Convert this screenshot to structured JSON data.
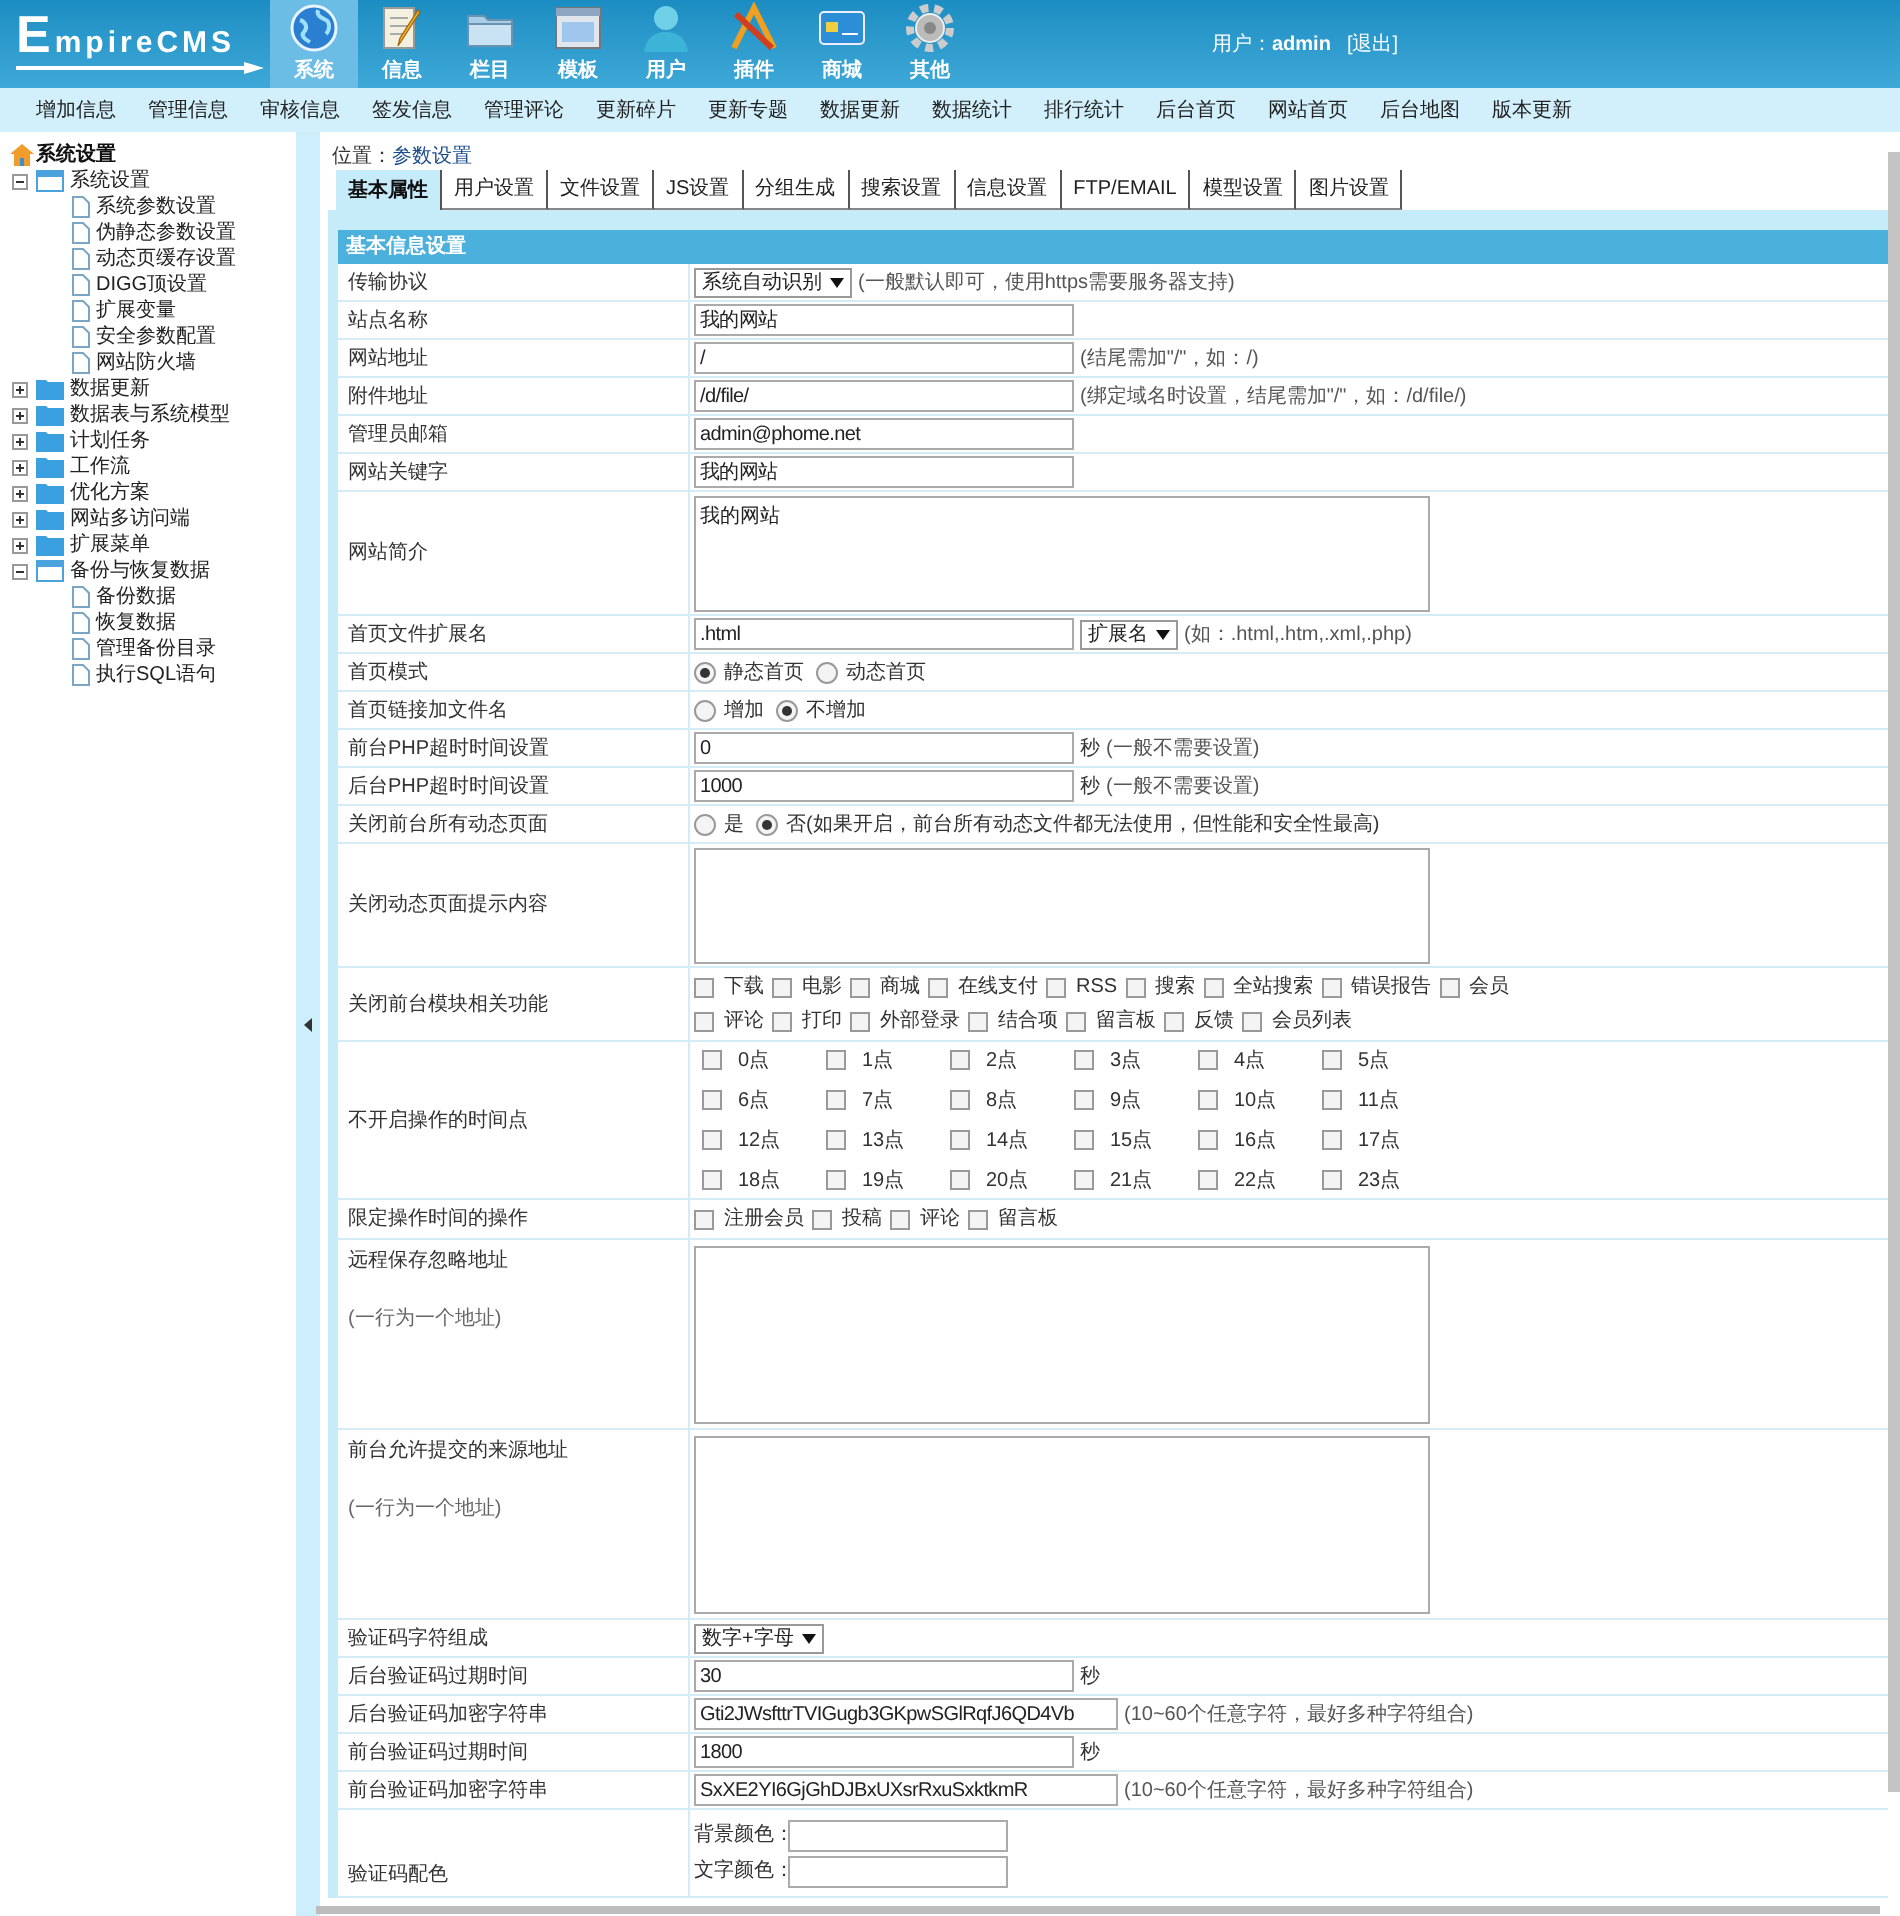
{
  "header": {
    "logo": "EmpireCMS",
    "nav": [
      {
        "label": "系统",
        "selected": true
      },
      {
        "label": "信息",
        "selected": false
      },
      {
        "label": "栏目",
        "selected": false
      },
      {
        "label": "模板",
        "selected": false
      },
      {
        "label": "用户",
        "selected": false
      },
      {
        "label": "插件",
        "selected": false
      },
      {
        "label": "商城",
        "selected": false
      },
      {
        "label": "其他",
        "selected": false
      }
    ],
    "user_label": "用户：",
    "user": "admin",
    "logout": "[退出]"
  },
  "submenu": [
    "增加信息",
    "管理信息",
    "审核信息",
    "签发信息",
    "管理评论",
    "更新碎片",
    "更新专题",
    "数据更新",
    "数据统计",
    "排行统计",
    "后台首页",
    "网站首页",
    "后台地图",
    "版本更新"
  ],
  "sidebar": {
    "title": "系统设置",
    "tree": [
      {
        "label": "系统设置",
        "expanded": true,
        "children": [
          {
            "label": "系统参数设置"
          },
          {
            "label": "伪静态参数设置"
          },
          {
            "label": "动态页缓存设置"
          },
          {
            "label": "DIGG顶设置"
          },
          {
            "label": "扩展变量"
          },
          {
            "label": "安全参数配置"
          },
          {
            "label": "网站防火墙"
          }
        ]
      },
      {
        "label": "数据更新",
        "expanded": false
      },
      {
        "label": "数据表与系统模型",
        "expanded": false
      },
      {
        "label": "计划任务",
        "expanded": false
      },
      {
        "label": "工作流",
        "expanded": false
      },
      {
        "label": "优化方案",
        "expanded": false
      },
      {
        "label": "网站多访问端",
        "expanded": false
      },
      {
        "label": "扩展菜单",
        "expanded": false
      },
      {
        "label": "备份与恢复数据",
        "expanded": true,
        "children": [
          {
            "label": "备份数据"
          },
          {
            "label": "恢复数据"
          },
          {
            "label": "管理备份目录"
          },
          {
            "label": "执行SQL语句"
          }
        ]
      }
    ]
  },
  "breadcrumb": {
    "label": "位置：",
    "link": "参数设置"
  },
  "tabs": [
    {
      "label": "基本属性",
      "selected": true
    },
    {
      "label": "用户设置",
      "selected": false
    },
    {
      "label": "文件设置",
      "selected": false
    },
    {
      "label": "JS设置",
      "selected": false
    },
    {
      "label": "分组生成",
      "selected": false
    },
    {
      "label": "搜索设置",
      "selected": false
    },
    {
      "label": "信息设置",
      "selected": false
    },
    {
      "label": "FTP/EMAIL",
      "selected": false
    },
    {
      "label": "模型设置",
      "selected": false
    },
    {
      "label": "图片设置",
      "selected": false
    }
  ],
  "section_title": "基本信息设置",
  "rows": [
    {
      "kind": "select",
      "label": "传输协议",
      "value": "系统自动识别",
      "hint": "(一般默认即可，使用https需要服务器支持)"
    },
    {
      "kind": "text",
      "label": "站点名称",
      "value": "我的网站"
    },
    {
      "kind": "text",
      "label": "网站地址",
      "value": "/",
      "hint": "(结尾需加\"/\"，如：/)"
    },
    {
      "kind": "text",
      "label": "附件地址",
      "value": "/d/file/",
      "hint": "(绑定域名时设置，结尾需加\"/\"，如：/d/file/)"
    },
    {
      "kind": "text",
      "label": "管理员邮箱",
      "value": "admin@phome.net"
    },
    {
      "kind": "text",
      "label": "网站关键字",
      "value": "我的网站"
    },
    {
      "kind": "textarea",
      "label": "网站简介",
      "value": "我的网站"
    },
    {
      "kind": "text",
      "label": "首页文件扩展名",
      "value": ".html",
      "select": "扩展名",
      "hint": "(如：.html,.htm,.xml,.php)"
    },
    {
      "kind": "radio",
      "label": "首页模式",
      "options": [
        {
          "label": "静态首页",
          "selected": true
        },
        {
          "label": "动态首页",
          "selected": false
        }
      ]
    },
    {
      "kind": "radio",
      "label": "首页链接加文件名",
      "options": [
        {
          "label": "增加",
          "selected": false
        },
        {
          "label": "不增加",
          "selected": true
        }
      ]
    },
    {
      "kind": "text",
      "label": "前台PHP超时时间设置",
      "value": "0",
      "unit": "秒",
      "hint": "(一般不需要设置)"
    },
    {
      "kind": "text",
      "label": "后台PHP超时时间设置",
      "value": "1000",
      "unit": "秒",
      "hint": "(一般不需要设置)"
    },
    {
      "kind": "radio",
      "label": "关闭前台所有动态页面",
      "options": [
        {
          "label": "是",
          "selected": false
        },
        {
          "label": "否(如果开启，前台所有动态文件都无法使用，但性能和安全性最高)",
          "selected": true
        }
      ]
    },
    {
      "kind": "textarea",
      "label": "关闭动态页面提示内容"
    },
    {
      "kind": "checks",
      "label": "关闭前台模块相关功能",
      "options": [
        {
          "label": "下载",
          "checked": false
        },
        {
          "label": "电影",
          "checked": false
        },
        {
          "label": "商城",
          "checked": false
        },
        {
          "label": "在线支付",
          "checked": false
        },
        {
          "label": "RSS",
          "checked": false
        },
        {
          "label": "搜索",
          "checked": false
        },
        {
          "label": "全站搜索",
          "checked": false
        },
        {
          "label": "错误报告",
          "checked": false
        },
        {
          "label": "会员",
          "checked": false
        },
        {
          "label": "评论",
          "checked": false
        },
        {
          "label": "打印",
          "checked": false
        },
        {
          "label": "外部登录",
          "checked": false
        },
        {
          "label": "结合项",
          "checked": false
        },
        {
          "label": "留言板",
          "checked": false
        },
        {
          "label": "反馈",
          "checked": false
        },
        {
          "label": "会员列表",
          "checked": false
        }
      ]
    },
    {
      "kind": "grid",
      "label": "不开启操作的时间点",
      "options": [
        {
          "label": "0点",
          "checked": false
        },
        {
          "label": "1点",
          "checked": false
        },
        {
          "label": "2点",
          "checked": false
        },
        {
          "label": "3点",
          "checked": false
        },
        {
          "label": "4点",
          "checked": false
        },
        {
          "label": "5点",
          "checked": false
        },
        {
          "label": "6点",
          "checked": false
        },
        {
          "label": "7点",
          "checked": false
        },
        {
          "label": "8点",
          "checked": false
        },
        {
          "label": "9点",
          "checked": false
        },
        {
          "label": "10点",
          "checked": false
        },
        {
          "label": "11点",
          "checked": false
        },
        {
          "label": "12点",
          "checked": false
        },
        {
          "label": "13点",
          "checked": false
        },
        {
          "label": "14点",
          "checked": false
        },
        {
          "label": "15点",
          "checked": false
        },
        {
          "label": "16点",
          "checked": false
        },
        {
          "label": "17点",
          "checked": false
        },
        {
          "label": "18点",
          "checked": false
        },
        {
          "label": "19点",
          "checked": false
        },
        {
          "label": "20点",
          "checked": false
        },
        {
          "label": "21点",
          "checked": false
        },
        {
          "label": "22点",
          "checked": false
        },
        {
          "label": "23点",
          "checked": false
        }
      ]
    },
    {
      "kind": "checks",
      "label": "限定操作时间的操作",
      "options": [
        {
          "label": "注册会员",
          "checked": false
        },
        {
          "label": "投稿",
          "checked": false
        },
        {
          "label": "评论",
          "checked": false
        },
        {
          "label": "留言板",
          "checked": false
        }
      ]
    },
    {
      "kind": "bigtext",
      "label": "远程保存忽略地址",
      "note": "(一行为一个地址)"
    },
    {
      "kind": "bigtext",
      "label": "前台允许提交的来源地址",
      "note": "(一行为一个地址)"
    },
    {
      "kind": "select",
      "label": "验证码字符组成",
      "value": "数字+字母"
    },
    {
      "kind": "text",
      "label": "后台验证码过期时间",
      "value": "30",
      "unit": "秒"
    },
    {
      "kind": "text",
      "label": "后台验证码加密字符串",
      "value": "Gti2JWsfttrTVIGugb3GKpwSGlRqfJ6QD4Vb",
      "hint": "(10~60个任意字符，最好多种字符组合)"
    },
    {
      "kind": "text",
      "label": "前台验证码过期时间",
      "value": "1800",
      "unit": "秒"
    },
    {
      "kind": "text",
      "label": "前台验证码加密字符串",
      "value": "SxXE2YI6GjGhDJBxUXsrRxuSxktkmR",
      "hint": "(10~60个任意字符，最好多种字符组合)"
    },
    {
      "kind": "colors",
      "label": "验证码配色",
      "fields": [
        {
          "label": "背景颜色："
        },
        {
          "label": "文字颜色："
        }
      ]
    }
  ]
}
